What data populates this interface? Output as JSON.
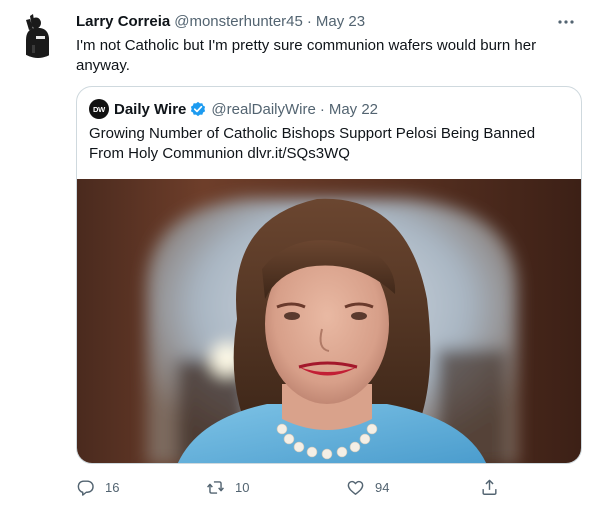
{
  "tweet": {
    "author": {
      "display_name": "Larry Correia",
      "handle": "@monsterhunter45",
      "avatar_icon": "silhouette-avatar-icon"
    },
    "separator": "·",
    "timestamp": "May 23",
    "text": "I'm not Catholic but I'm pretty sure communion wafers would burn her anyway.",
    "more_icon": "more-horizontal-icon"
  },
  "quote": {
    "author": {
      "display_name": "Daily Wire",
      "handle": "@realDailyWire",
      "avatar_text": "DW",
      "verified": true
    },
    "separator": "·",
    "timestamp": "May 22",
    "text": "Growing Number of Catholic Bishops Support Pelosi Being Banned From Holy Communion dlvr.it/SQs3WQ",
    "media": "photo of a smiling woman with shoulder-length brown hair, pearl necklace and light blue jacket"
  },
  "actions": {
    "reply_count": "16",
    "retweet_count": "10",
    "like_count": "94",
    "icons": [
      "reply-icon",
      "retweet-icon",
      "like-icon",
      "share-icon"
    ]
  },
  "colors": {
    "text": "#0f1419",
    "secondary": "#536471",
    "border": "#cfd9de",
    "verified": "#1d9bf0"
  }
}
